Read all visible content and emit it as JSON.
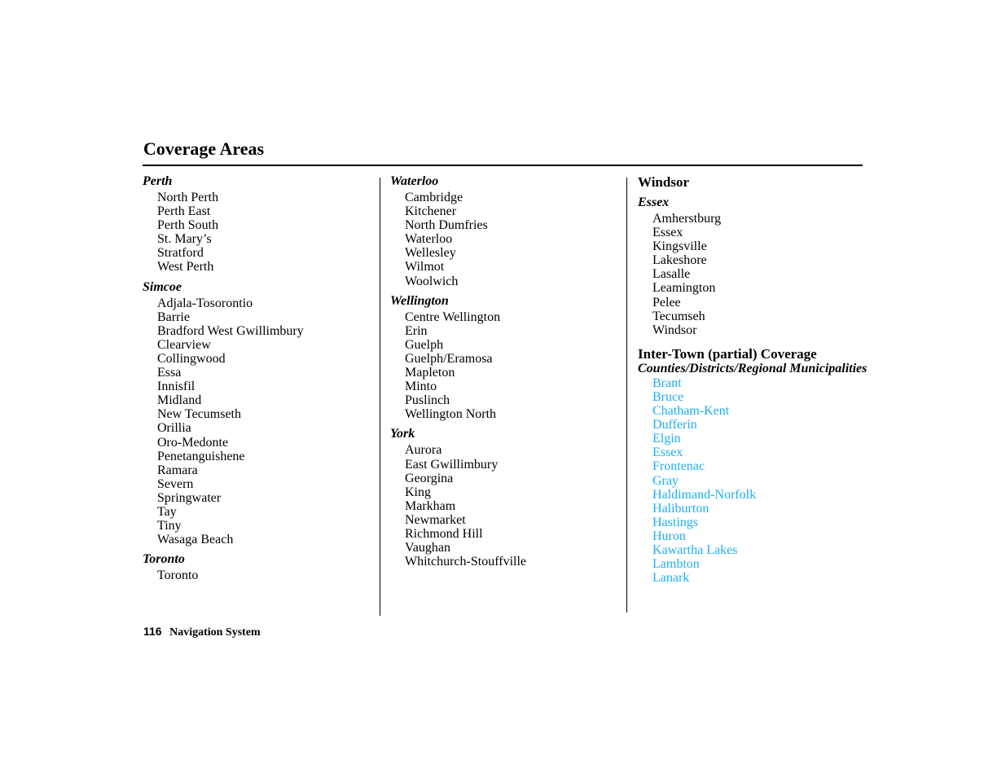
{
  "title": "Coverage Areas",
  "columns": [
    {
      "groups": [
        {
          "heading": "Perth",
          "items": [
            "North Perth",
            "Perth East",
            "Perth South",
            "St. Mary’s",
            "Stratford",
            "West Perth"
          ]
        },
        {
          "heading": "Simcoe",
          "items": [
            "Adjala-Tosorontio",
            "Barrie",
            "Bradford West Gwillimbury",
            "Clearview",
            "Collingwood",
            "Essa",
            "Innisfil",
            "Midland",
            "New Tecumseth",
            "Orillia",
            "Oro-Medonte",
            "Penetanguishene",
            "Ramara",
            "Severn",
            "Springwater",
            "Tay",
            "Tiny",
            "Wasaga Beach"
          ]
        },
        {
          "heading": "Toronto",
          "items": [
            "Toronto"
          ]
        }
      ]
    },
    {
      "groups": [
        {
          "heading": "Waterloo",
          "items": [
            "Cambridge",
            "Kitchener",
            "North Dumfries",
            "Waterloo",
            "Wellesley",
            "Wilmot",
            "Woolwich"
          ]
        },
        {
          "heading": "Wellington",
          "items": [
            "Centre Wellington",
            "Erin",
            "Guelph",
            "Guelph/Eramosa",
            "Mapleton",
            "Minto",
            "Puslinch",
            "Wellington North"
          ]
        },
        {
          "heading": "York",
          "items": [
            "Aurora",
            "East Gwillimbury",
            "Georgina",
            "King",
            "Markham",
            "Newmarket",
            "Richmond Hill",
            "Vaughan",
            "Whitchurch-Stouffville"
          ]
        }
      ]
    },
    {
      "city": "Windsor",
      "groups": [
        {
          "heading": "Essex",
          "items": [
            "Amherstburg",
            "Essex",
            "Kingsville",
            "Lakeshore",
            "Lasalle",
            "Leamington",
            "Pelee",
            "Tecumseh",
            "Windsor"
          ]
        }
      ],
      "intertown": {
        "heading": "Inter-Town (partial) Coverage",
        "subheading": "Counties/Districts/Regional Municipalities",
        "links": [
          "Brant",
          "Bruce",
          "Chatham-Kent",
          "Dufferin",
          "Elgin",
          "Essex",
          "Frontenac",
          "Gray",
          "Haldimand-Norfolk",
          "Haliburton",
          "Hastings",
          "Huron",
          "Kawartha Lakes",
          "Lambton",
          "Lanark"
        ]
      }
    }
  ],
  "footer": {
    "page_number": "116",
    "title": "Navigation System"
  },
  "colors": {
    "link": "#1eaef0",
    "text": "#000000"
  }
}
